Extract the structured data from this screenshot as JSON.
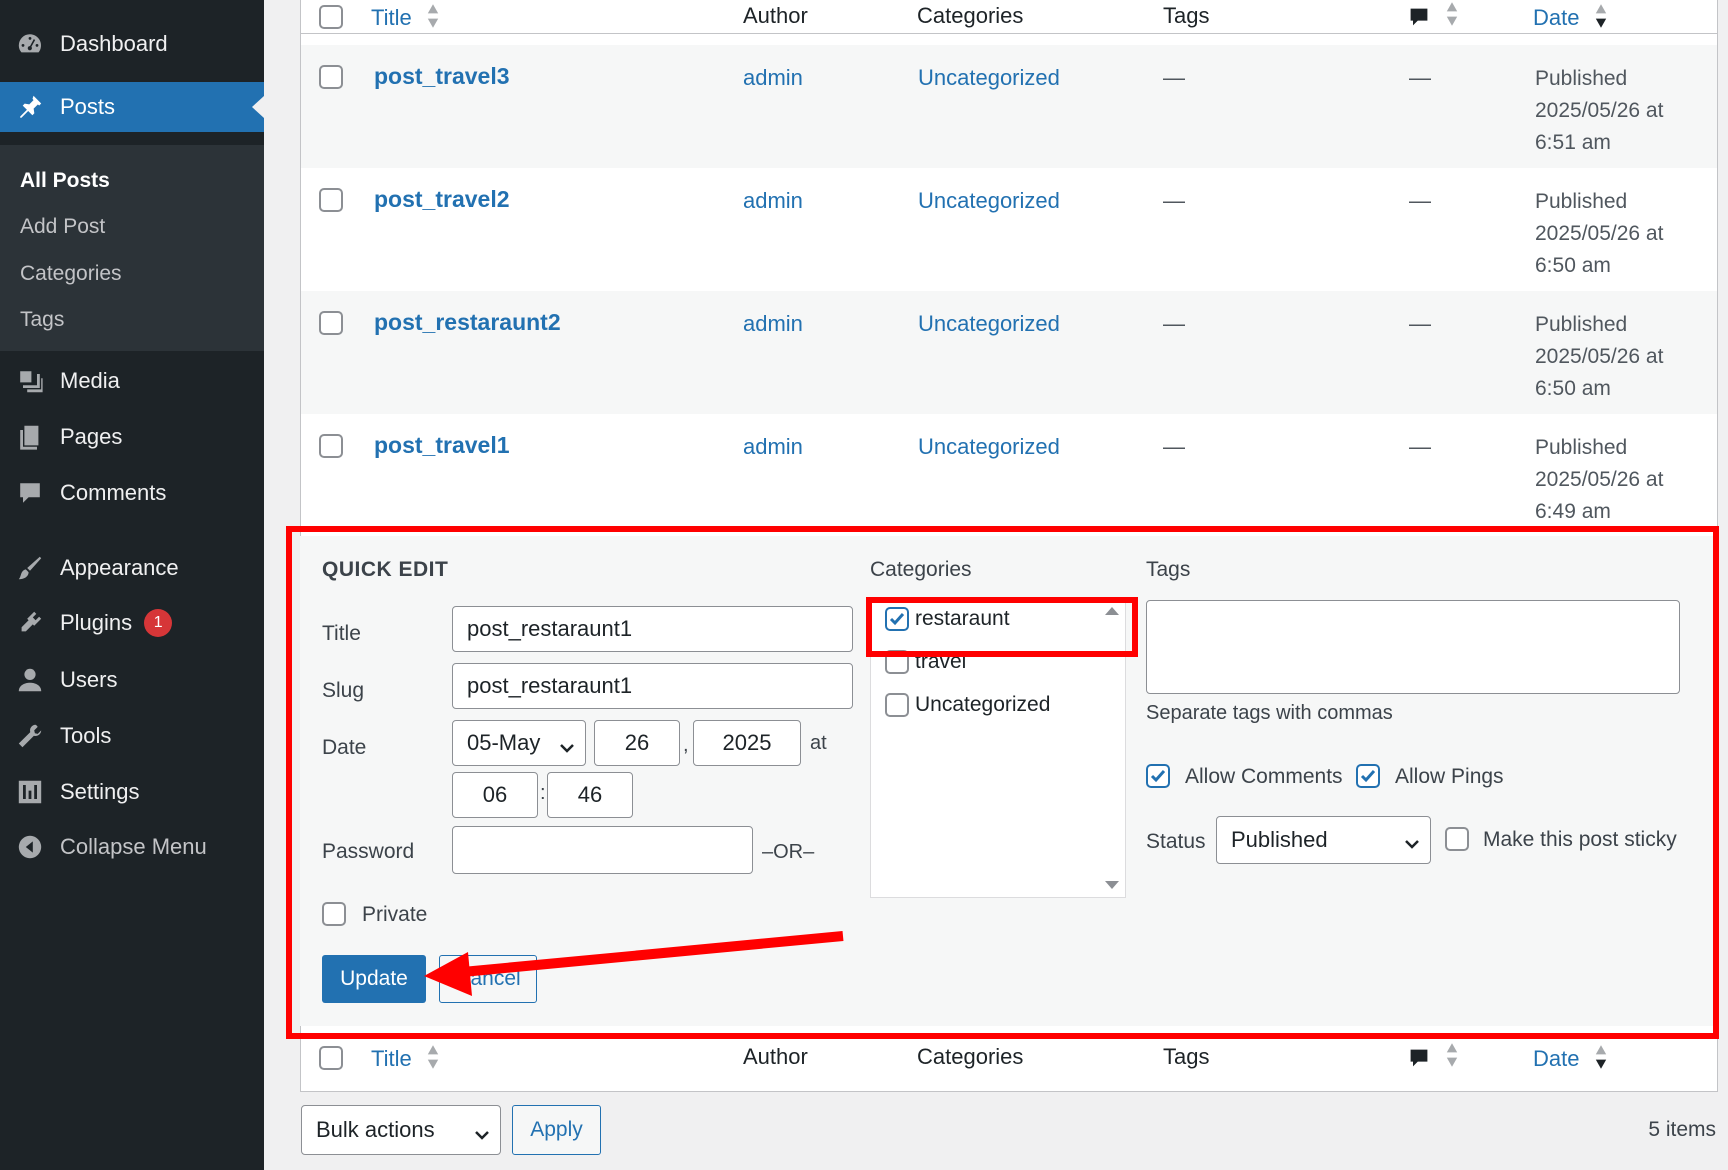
{
  "sidebar": {
    "menu": [
      {
        "label": "Dashboard",
        "icon": "dashboard-icon"
      },
      {
        "label": "Posts",
        "icon": "pin-icon",
        "active": true
      },
      {
        "label": "Media",
        "icon": "media-icon"
      },
      {
        "label": "Pages",
        "icon": "pages-icon"
      },
      {
        "label": "Comments",
        "icon": "comment-icon"
      },
      {
        "label": "Appearance",
        "icon": "brush-icon"
      },
      {
        "label": "Plugins",
        "icon": "plugin-icon",
        "badge": "1"
      },
      {
        "label": "Users",
        "icon": "user-icon"
      },
      {
        "label": "Tools",
        "icon": "wrench-icon"
      },
      {
        "label": "Settings",
        "icon": "settings-icon"
      },
      {
        "label": "Collapse Menu",
        "icon": "collapse-icon"
      }
    ],
    "submenu": [
      "All Posts",
      "Add Post",
      "Categories",
      "Tags"
    ]
  },
  "table": {
    "columns": {
      "title": "Title",
      "author": "Author",
      "categories": "Categories",
      "tags": "Tags",
      "date": "Date"
    },
    "rows": [
      {
        "title": "post_travel3",
        "author": "admin",
        "category": "Uncategorized",
        "tags": "—",
        "comments": "—",
        "date_status": "Published",
        "date_value": "2025/05/26 at",
        "date_time": "6:51 am"
      },
      {
        "title": "post_travel2",
        "author": "admin",
        "category": "Uncategorized",
        "tags": "—",
        "comments": "—",
        "date_status": "Published",
        "date_value": "2025/05/26 at",
        "date_time": "6:50 am"
      },
      {
        "title": "post_restaraunt2",
        "author": "admin",
        "category": "Uncategorized",
        "tags": "—",
        "comments": "—",
        "date_status": "Published",
        "date_value": "2025/05/26 at",
        "date_time": "6:50 am"
      },
      {
        "title": "post_travel1",
        "author": "admin",
        "category": "Uncategorized",
        "tags": "—",
        "comments": "—",
        "date_status": "Published",
        "date_value": "2025/05/26 at",
        "date_time": "6:49 am"
      }
    ]
  },
  "quick_edit": {
    "heading": "QUICK EDIT",
    "title_label": "Title",
    "title_value": "post_restaraunt1",
    "slug_label": "Slug",
    "slug_value": "post_restaraunt1",
    "date_label": "Date",
    "month": "05-May",
    "day": "26",
    "comma": ",",
    "year": "2025",
    "at": "at",
    "hour": "06",
    "colon": ":",
    "minute": "46",
    "password_label": "Password",
    "password_value": "",
    "or": "–OR–",
    "private_label": "Private",
    "categories_label": "Categories",
    "categories": [
      {
        "name": "restaraunt",
        "checked": true
      },
      {
        "name": "travel",
        "checked": false
      },
      {
        "name": "Uncategorized",
        "checked": false
      }
    ],
    "tags_label": "Tags",
    "tags_value": "",
    "tags_hint": "Separate tags with commas",
    "allow_comments": "Allow Comments",
    "allow_pings": "Allow Pings",
    "status_label": "Status",
    "status_value": "Published",
    "sticky_label": "Make this post sticky",
    "update_button": "Update",
    "cancel_button": "Cancel"
  },
  "footer": {
    "bulk_actions": "Bulk actions",
    "apply": "Apply",
    "items": "5 items"
  },
  "colors": {
    "sidebar_bg": "#1d2327",
    "accent": "#2271b1",
    "annotation": "#ff0000",
    "badge": "#d63638"
  }
}
